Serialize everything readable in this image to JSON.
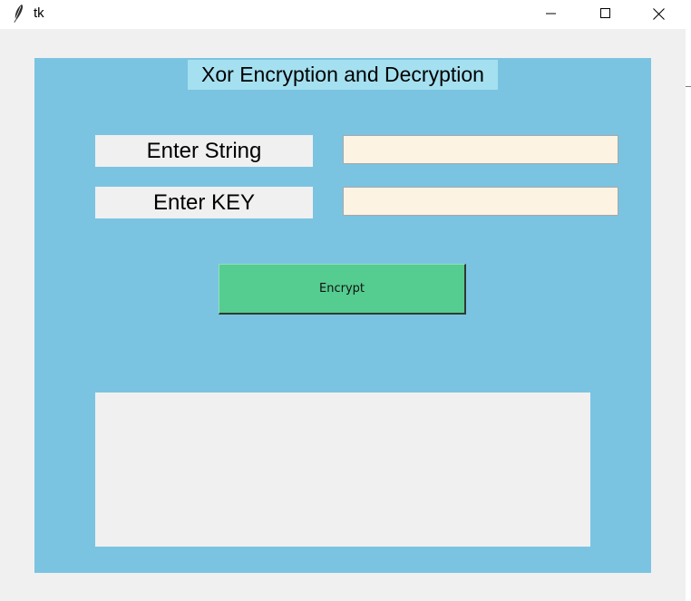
{
  "window": {
    "title": "tk",
    "app_icon": "feather-icon",
    "controls": [
      "minimize-icon",
      "maximize-icon",
      "close-icon"
    ]
  },
  "app": {
    "heading": "Xor Encryption and Decryption",
    "string_label": "Enter String",
    "key_label": "Enter KEY",
    "string_value": "",
    "key_value": "",
    "encrypt_label": "Encrypt",
    "output_text": ""
  },
  "colors": {
    "panel": "#7ac4e2",
    "heading_bg": "#a4e0f0",
    "entry_bg": "#fdf3e3",
    "button": "#55cc90",
    "window_bg": "#f0f0f0"
  }
}
